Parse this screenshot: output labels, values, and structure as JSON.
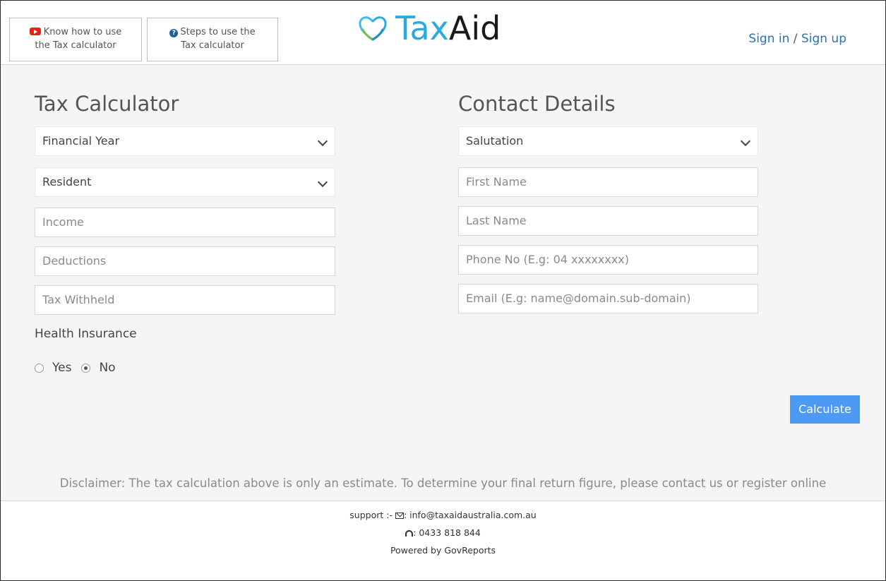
{
  "header": {
    "help_video": {
      "line1": "Know how to use",
      "line2": "the Tax calculator"
    },
    "help_steps": {
      "line1": "Steps to use the",
      "line2": "Tax calculator"
    },
    "logo": {
      "part1": "Tax",
      "part2": "Aid"
    },
    "signin": {
      "sign_in": "Sign in",
      "separator": " / ",
      "sign_up": "Sign up"
    }
  },
  "tax_calculator": {
    "title": "Tax Calculator",
    "financial_year": "Financial Year",
    "residency": "Resident",
    "income_placeholder": "Income",
    "deductions_placeholder": "Deductions",
    "tax_withheld_placeholder": "Tax Withheld",
    "health_insurance_label": "Health Insurance",
    "option_yes": "Yes",
    "option_no": "No",
    "selected_option": "No"
  },
  "contact_details": {
    "title": "Contact Details",
    "salutation": "Salutation",
    "first_name_placeholder": "First Name",
    "last_name_placeholder": "Last Name",
    "phone_placeholder": "Phone No (E.g: 04 xxxxxxxx)",
    "email_placeholder": "Email (E.g: name@domain.sub-domain)"
  },
  "calculate_label": "Calculate",
  "disclaimer": "Disclaimer: The tax calculation above is only an estimate. To determine your final return figure, please contact us or register online",
  "footer": {
    "support_label": "support :-",
    "email": ": info@taxaidaustralia.com.au",
    "phone": ": 0433 818 844",
    "powered_by": "Powered by GovReports"
  },
  "colors": {
    "brand_blue": "#29abe2",
    "link_blue": "#2f6fb5",
    "button_blue": "#4d9af4",
    "youtube_red": "#e62117"
  }
}
